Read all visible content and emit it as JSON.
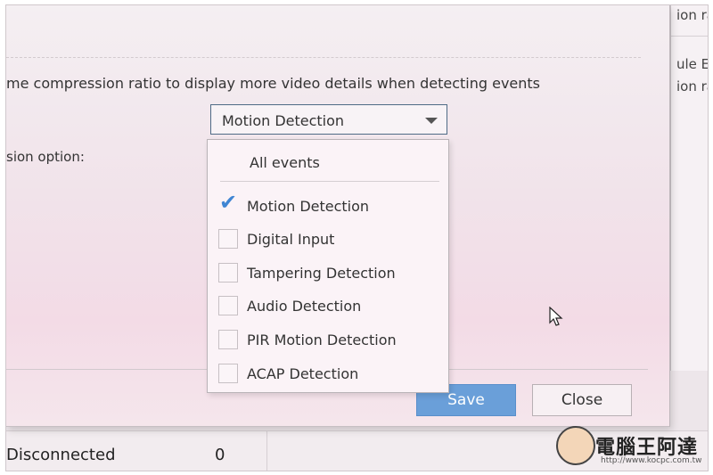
{
  "background_page": {
    "right_panel_lines": [
      "ion ra",
      "ule E",
      "ion ra"
    ],
    "status_label": "Disconnected",
    "status_count": "0"
  },
  "dialog": {
    "description": "me compression ratio to display more video details when detecting events",
    "option_label": "sion option:",
    "select": {
      "value": "Motion Detection",
      "icon": "chevron-down-icon"
    },
    "dropdown": {
      "all_events_label": "All events",
      "items": [
        {
          "label": "Motion Detection",
          "checked": true
        },
        {
          "label": "Digital Input",
          "checked": false
        },
        {
          "label": "Tampering Detection",
          "checked": false
        },
        {
          "label": "Audio Detection",
          "checked": false
        },
        {
          "label": "PIR Motion Detection",
          "checked": false
        },
        {
          "label": "ACAP Detection",
          "checked": false
        }
      ]
    },
    "buttons": {
      "save": "Save",
      "close": "Close"
    },
    "accent_color": "#6a9fd9",
    "check_color": "#3f85d3"
  },
  "watermark": {
    "text": "電腦王阿達",
    "url": "http://www.kocpc.com.tw"
  }
}
